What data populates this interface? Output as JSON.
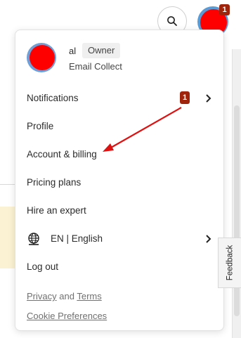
{
  "colors": {
    "badge": "#a0240b",
    "avatar_red": "#ff0000",
    "avatar_ring": "#5b9bd5",
    "annotation_arrow": "#e01010",
    "highlight_bg": "#fbf1d3"
  },
  "header": {
    "search_icon": "search-icon",
    "avatar_badge_count": "1"
  },
  "profile": {
    "name": "al",
    "role": "Owner",
    "org": "Email Collect"
  },
  "menu": {
    "notifications": {
      "label": "Notifications",
      "badge": "1"
    },
    "profile": "Profile",
    "account_billing": "Account & billing",
    "pricing_plans": "Pricing plans",
    "hire_expert": "Hire an expert",
    "language": {
      "label": "EN | English",
      "icon": "globe-icon"
    },
    "log_out": "Log out"
  },
  "footer": {
    "privacy": "Privacy",
    "and": "and",
    "terms": "Terms",
    "cookie_preferences": "Cookie Preferences"
  },
  "feedback_tab": "Feedback"
}
